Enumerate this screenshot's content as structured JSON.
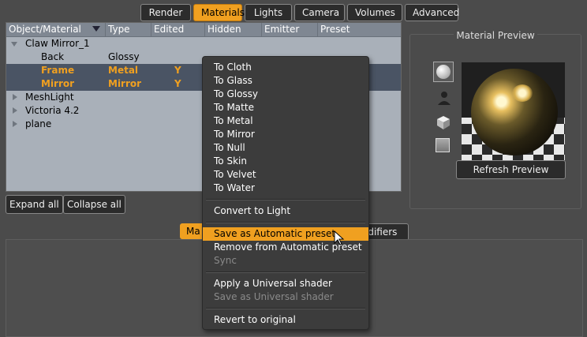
{
  "tabs": [
    "Render",
    "Materials",
    "Lights",
    "Camera",
    "Volumes",
    "Advanced"
  ],
  "active_tab": "Materials",
  "tree": {
    "columns": [
      "Object/Material",
      "Type",
      "Edited",
      "Hidden",
      "Emitter",
      "Preset"
    ],
    "rows": [
      {
        "name": "Claw Mirror_1",
        "type": "",
        "edited": "",
        "expander": "open"
      },
      {
        "name": "Back",
        "type": "Glossy",
        "edited": ""
      },
      {
        "name": "Frame",
        "type": "Metal",
        "edited": "Y",
        "selected": true
      },
      {
        "name": "Mirror",
        "type": "Mirror",
        "edited": "Y",
        "selected": true
      },
      {
        "name": "MeshLight",
        "type": "",
        "edited": "",
        "expander": "closed"
      },
      {
        "name": "Victoria 4.2",
        "type": "",
        "edited": "",
        "expander": "closed"
      },
      {
        "name": "plane",
        "type": "",
        "edited": "",
        "expander": "closed"
      }
    ]
  },
  "buttons": {
    "expand_all": "Expand all",
    "collapse_all": "Collapse all",
    "refresh_preview": "Refresh Preview"
  },
  "preview": {
    "title": "Material Preview"
  },
  "lower_tabs": {
    "left_partial": "Ma",
    "right_partial": "odifiers"
  },
  "context_menu": {
    "items": [
      {
        "label": "To Cloth",
        "enabled": true
      },
      {
        "label": "To Glass",
        "enabled": true
      },
      {
        "label": "To Glossy",
        "enabled": true
      },
      {
        "label": "To Matte",
        "enabled": true
      },
      {
        "label": "To Metal",
        "enabled": true
      },
      {
        "label": "To Mirror",
        "enabled": true
      },
      {
        "label": "To Null",
        "enabled": true
      },
      {
        "label": "To Skin",
        "enabled": true
      },
      {
        "label": "To Velvet",
        "enabled": true
      },
      {
        "label": "To Water",
        "enabled": true
      },
      {
        "label": "Convert to Light",
        "enabled": true
      },
      {
        "label": "Save as Automatic preset",
        "enabled": true,
        "highlighted": true
      },
      {
        "label": "Remove from Automatic preset",
        "enabled": true
      },
      {
        "label": "Sync",
        "enabled": false
      },
      {
        "label": "Apply a Universal shader",
        "enabled": true
      },
      {
        "label": "Save as Universal shader",
        "enabled": false
      },
      {
        "label": "Revert to original",
        "enabled": true
      }
    ]
  },
  "colors": {
    "accent": "#f0a020",
    "background": "#4b4b4b",
    "tree_background": "#a9b0b9",
    "selected_row": "#4a5464"
  }
}
